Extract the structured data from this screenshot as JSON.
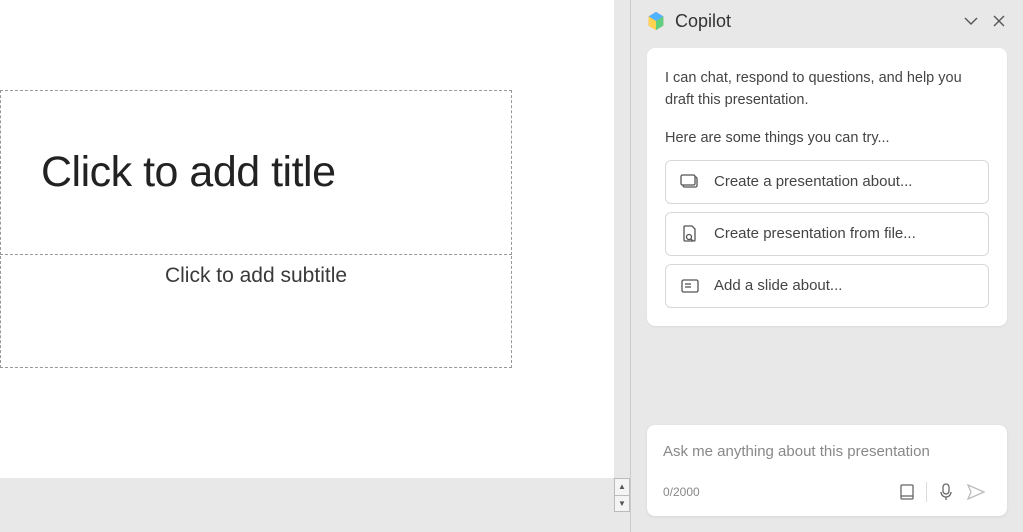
{
  "slide": {
    "title_placeholder": "Click to add title",
    "subtitle_placeholder": "Click to add subtitle"
  },
  "copilot": {
    "title": "Copilot",
    "intro": "I can chat, respond to questions, and help you draft this presentation.",
    "try_prompt": "Here are some things you can try...",
    "suggestions": [
      {
        "icon": "presentation-outline-icon",
        "label": "Create a presentation about..."
      },
      {
        "icon": "file-search-icon",
        "label": "Create presentation from file..."
      },
      {
        "icon": "slide-add-icon",
        "label": "Add a slide about..."
      }
    ],
    "input": {
      "placeholder": "Ask me anything about this presentation",
      "char_count": "0/2000"
    }
  }
}
